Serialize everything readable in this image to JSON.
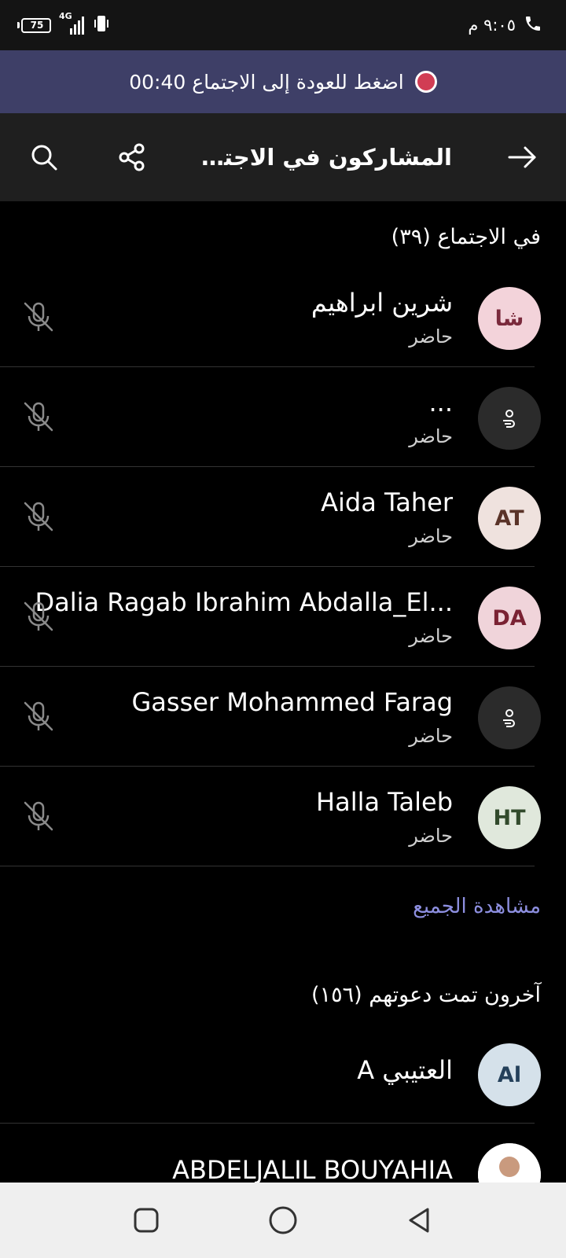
{
  "status_bar": {
    "time": "٩:٠٥ م",
    "battery_level": "75",
    "network": "4G"
  },
  "banner": {
    "text": "اضغط للعودة إلى الاجتماع 00:40",
    "recording_color": "#d13d54"
  },
  "header": {
    "title": "المشاركون في الاجتماع",
    "back_icon": "arrow-right-icon",
    "share_icon": "share-icon",
    "search_icon": "search-icon"
  },
  "in_meeting": {
    "heading": "في الاجتماع (٣٩)",
    "participants": [
      {
        "name": "شرين ابراهيم",
        "status": "حاضر",
        "initials": "شا",
        "avatar_bg": "#f3d3da",
        "avatar_fg": "#7a2a3c"
      },
      {
        "name": "...",
        "status": "حاضر",
        "initials": "",
        "avatar_bg": "#2b2b2b",
        "avatar_fg": "#ffffff"
      },
      {
        "name": "Aida Taher",
        "status": "حاضر",
        "initials": "AT",
        "avatar_bg": "#efe2de",
        "avatar_fg": "#5a3328"
      },
      {
        "name": "Dalia Ragab Ibrahim Abdalla_El...",
        "status": "حاضر",
        "initials": "DA",
        "avatar_bg": "#f0d4da",
        "avatar_fg": "#7a2233"
      },
      {
        "name": "Gasser Mohammed Farag",
        "status": "حاضر",
        "initials": "",
        "avatar_bg": "#2b2b2b",
        "avatar_fg": "#ffffff"
      },
      {
        "name": "Halla Taleb",
        "status": "حاضر",
        "initials": "HT",
        "avatar_bg": "#e0e8dc",
        "avatar_fg": "#324a2c"
      }
    ],
    "see_all": "مشاهدة الجميع"
  },
  "invited": {
    "heading": "آخرون تمت دعوتهم (١٥٦)",
    "people": [
      {
        "name": "العتيبي A",
        "initials": "Al",
        "avatar_bg": "#d5e1ea",
        "avatar_fg": "#24405a"
      },
      {
        "name": "ABDELJALIL BOUYAHIA",
        "initials": "",
        "avatar_bg": "#ffffff",
        "avatar_fg": "#000000"
      }
    ]
  },
  "nav": {
    "recent_icon": "square-icon",
    "home_icon": "circle-icon",
    "back_icon": "triangle-back-icon"
  }
}
